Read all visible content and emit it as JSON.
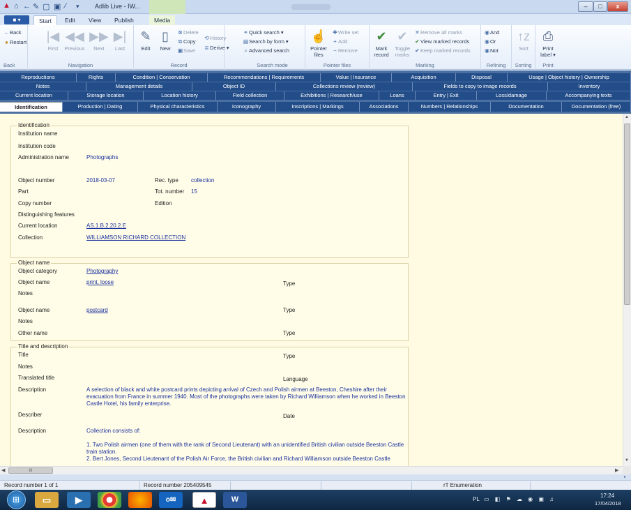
{
  "window": {
    "title": "Adlib Live - IW...",
    "context_tab": "Media",
    "buttons": {
      "minimize": "–",
      "maximize": "□",
      "close": "x"
    }
  },
  "ribbon_tabs": [
    "Start",
    "Edit",
    "View",
    "Publish",
    "Media"
  ],
  "active_ribbon_tab": "Start",
  "file_button": "■ ▾",
  "ribbon": {
    "back": {
      "back": "Back",
      "restart": "Restart",
      "group": "Back"
    },
    "navigation": {
      "first": "First",
      "previous": "Previous",
      "next": "Next",
      "last": "Last",
      "group": "Navigation"
    },
    "record": {
      "edit": "Edit",
      "new": "New",
      "delete": "Delete",
      "copy": "Copy",
      "save": "Save",
      "group": "Record"
    },
    "history": {
      "history": "History",
      "derive": "Derive ▾"
    },
    "search": {
      "quick": "Quick search ▾",
      "by_form": "Search by form ▾",
      "advanced": "Advanced search",
      "group": "Search mode"
    },
    "pointer": {
      "pointer_files": "Pointer files",
      "write_set": "Write set",
      "add": "Add",
      "remove": "Remove",
      "group": "Pointer files"
    },
    "marking": {
      "mark_record": "Mark record",
      "toggle_marks": "Toggle marks",
      "remove_all": "Remove all marks",
      "view_marked": "View marked records",
      "keep_marked": "Keep marked records",
      "group": "Marking"
    },
    "refining": {
      "and": "And",
      "or": "Or",
      "not": "Not",
      "group": "Refining"
    },
    "sorting": {
      "sort": "Sort",
      "group": "Sorting"
    },
    "print": {
      "print_label": "Print label ▾",
      "group": "Print"
    }
  },
  "form_tabs": {
    "row1": [
      "Reproductions",
      "Rights",
      "Condition | Conservation",
      "Recommendations | Requirements",
      "Value | Insurance",
      "Acquisition",
      "Disposal",
      "Usage | Object history | Ownership"
    ],
    "row2": [
      "Notes",
      "Management details",
      "Object ID",
      "Collections review (review)",
      "Fields to copy to image records",
      "Inventory"
    ],
    "row3": [
      "Current location",
      "Storage location",
      "Location history",
      "Field collection",
      "Exhibitions | Research/use",
      "Loans",
      "Entry | Exit",
      "Loss/damage",
      "Accompanying texts"
    ],
    "row4": [
      "Identification",
      "Production | Dating",
      "Physical characteristics",
      "Iconography",
      "Inscriptions | Markings",
      "Associations",
      "Numbers | Relationships",
      "Documentation",
      "Documentation (free)"
    ]
  },
  "active_form_tab": "Identification",
  "identification": {
    "legend": "Identification",
    "institution_name_label": "Institution name",
    "institution_code_label": "Institution code",
    "administration_name_label": "Administration name",
    "administration_name": "Photographs",
    "object_number_label": "Object number",
    "object_number": "2018-03-07",
    "rec_type_label": "Rec. type",
    "rec_type": "collection",
    "part_label": "Part",
    "tot_number_label": "Tot. number",
    "tot_number": "15",
    "copy_number_label": "Copy number",
    "edition_label": "Edition",
    "distinguishing_label": "Distinguishing features",
    "current_location_label": "Current location",
    "current_location": "AS.1.B.2.20.2.E",
    "collection_label": "Collection",
    "collection": "WILLIAMSON RICHARD COLLECTION"
  },
  "object_name": {
    "legend": "Object name",
    "category_label": "Object category",
    "category": "Photography",
    "name_label": "Object name",
    "name1": "print, loose",
    "type_label": "Type",
    "notes_label": "Notes",
    "name2": "postcard",
    "other_name_label": "Other name"
  },
  "title_description": {
    "legend": "Title and description",
    "title_label": "Title",
    "type_label": "Type",
    "notes_label": "Notes",
    "translated_title_label": "Translated title",
    "language_label": "Language",
    "description_label": "Description",
    "description1": "A selection of black and white postcard prints depicting arrival of Czech and Polish airmen at Beeston, Cheshire after their evacuation from France in summer 1940. Most of the photographs were taken by Richard Williamson when he worked in Beeston Castle Hotel, his family enterprise.",
    "describer_label": "Describer",
    "date_label": "Date",
    "description2_line1": "Collection consists of:",
    "description2_line2": "1. Two Polish airmen (one of them with the rank of Second Lieutenant) with an unidentified British civilian outside Beeston Castle train station.",
    "description2_line3": "2. Bert Jones, Second Lieutenant of the Polish Air Force, the British civilian and Richard Williamson outside Beeston Castle"
  },
  "hscroll_thumb": "III",
  "status": {
    "record_count": "Record number 1 of 1",
    "record_number": "Record number 205409545",
    "enumeration": "rT Enumeration"
  },
  "taskbar": {
    "lang": "PL",
    "time": "17:24",
    "date": "17/04/2018"
  }
}
